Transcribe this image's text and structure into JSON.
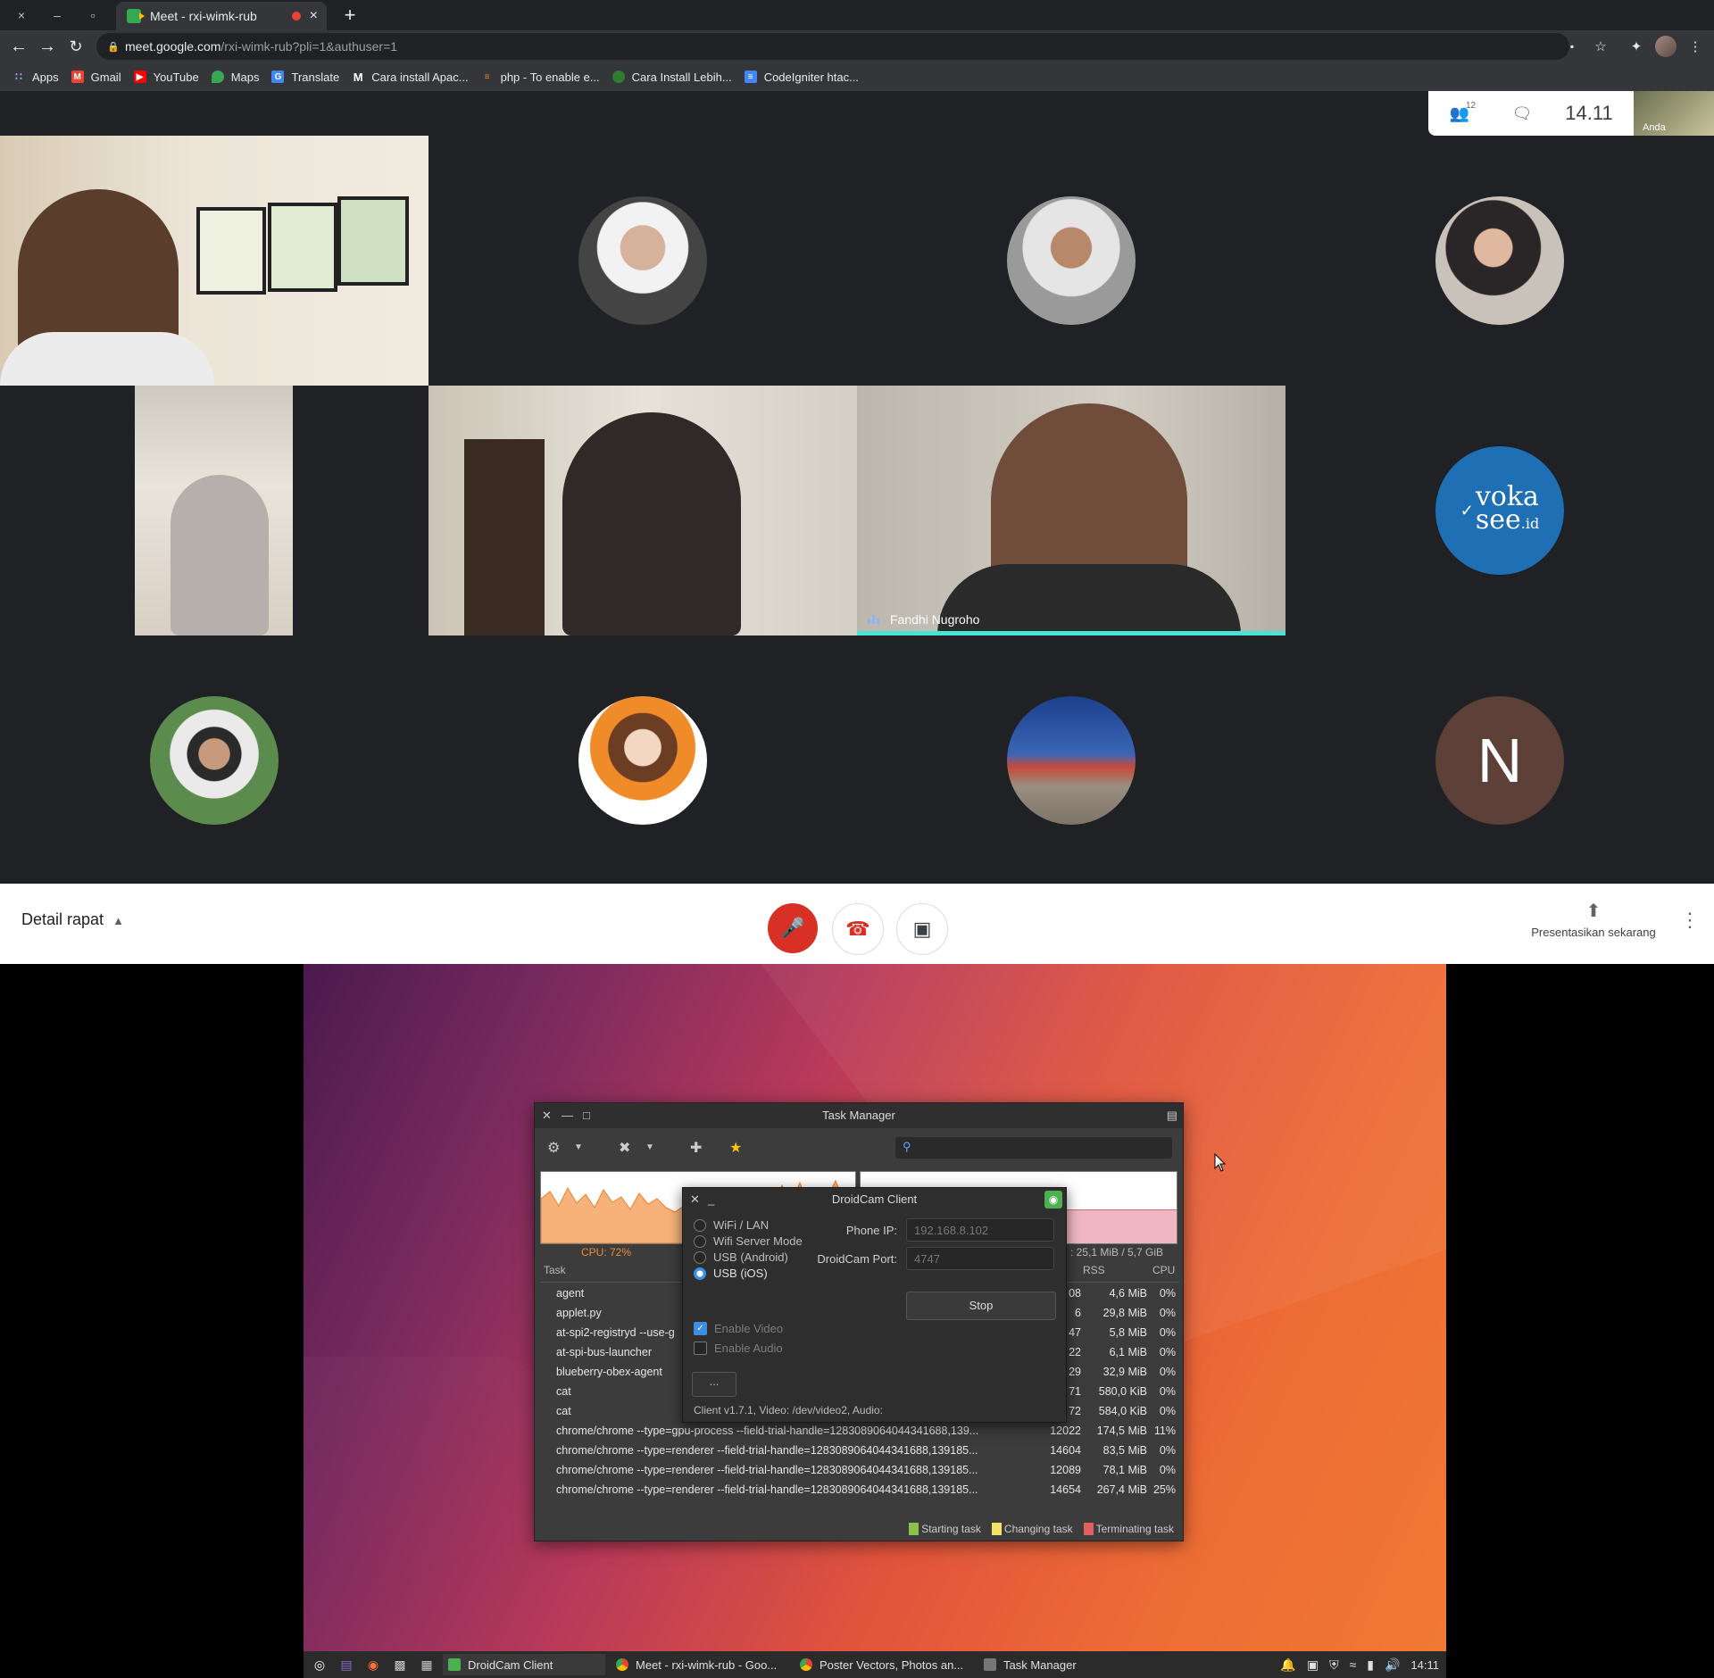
{
  "browser": {
    "window_controls": {
      "close": "×",
      "minimize": "–",
      "maximize": "▫"
    },
    "tab": {
      "title": "Meet - rxi-wimk-rub",
      "close": "×"
    },
    "new_tab": "+",
    "url": {
      "host": "meet.google.com",
      "path": "/rxi-wimk-rub?pli=1&authuser=1"
    },
    "bookmarks": [
      {
        "label": "Apps",
        "icon": "apps-grid-icon"
      },
      {
        "label": "Gmail",
        "icon": "gmail-icon"
      },
      {
        "label": "YouTube",
        "icon": "youtube-icon"
      },
      {
        "label": "Maps",
        "icon": "maps-icon"
      },
      {
        "label": "Translate",
        "icon": "translate-icon"
      },
      {
        "label": "Cara install Apac...",
        "icon": "medium-icon"
      },
      {
        "label": "php - To enable e...",
        "icon": "stackoverflow-icon"
      },
      {
        "label": "Cara Install Lebih...",
        "icon": "site-icon"
      },
      {
        "label": "CodeIgniter htac...",
        "icon": "doc-icon"
      }
    ]
  },
  "meet": {
    "participant_count": "12",
    "time": "14.11",
    "self_label": "Anda",
    "avatar_letter": "N",
    "avatar_logo": {
      "check": "✓",
      "line1": "voka",
      "line2": "see",
      "suffix": ".id"
    },
    "speaker_name": "Fandhi Nugroho",
    "meeting_details": "Detail rapat",
    "present_now": "Presentasikan sekarang",
    "colors": {
      "end_call": "#d93025",
      "speaking": "#48e3d2",
      "dark_bg": "#202124"
    }
  },
  "task_manager": {
    "title": "Task Manager",
    "cpu_label": "CPU: 72%",
    "mem_label": ": 25,1 MiB / 5,7 GiB",
    "columns": {
      "task": "Task",
      "rss": "RSS",
      "cpu": "CPU"
    },
    "rows": [
      {
        "name": "agent",
        "pid": "08",
        "rss": "4,6 MiB",
        "cpu": "0%"
      },
      {
        "name": "applet.py",
        "pid": "6",
        "rss": "29,8 MiB",
        "cpu": "0%"
      },
      {
        "name": "at-spi2-registryd --use-g",
        "pid": "47",
        "rss": "5,8 MiB",
        "cpu": "0%"
      },
      {
        "name": "at-spi-bus-launcher",
        "pid": "22",
        "rss": "6,1 MiB",
        "cpu": "0%"
      },
      {
        "name": "blueberry-obex-agent",
        "pid": "29",
        "rss": "32,9 MiB",
        "cpu": "0%"
      },
      {
        "name": "cat",
        "pid": "71",
        "rss": "580,0 KiB",
        "cpu": "0%"
      },
      {
        "name": "cat",
        "pid": "72",
        "rss": "584,0 KiB",
        "cpu": "0%"
      },
      {
        "name": "chrome/chrome --type=gpu-process --field-trial-handle=12830890640443416​88,139...",
        "pid": "12022",
        "rss": "174,5 MiB",
        "cpu": "11%"
      },
      {
        "name": "chrome/chrome --type=renderer --field-trial-handle=12830890640443416​88,139185...",
        "pid": "14604",
        "rss": "83,5 MiB",
        "cpu": "0%"
      },
      {
        "name": "chrome/chrome --type=renderer --field-trial-handle=12830890640443416​88,139185...",
        "pid": "12089",
        "rss": "78,1 MiB",
        "cpu": "0%"
      },
      {
        "name": "chrome/chrome --type=renderer --field-trial-handle=12830890640443416​88,139185...",
        "pid": "14654",
        "rss": "267,4 MiB",
        "cpu": "25%"
      }
    ],
    "legend": {
      "starting": "Starting task",
      "changing": "Changing task",
      "terminating": "Terminating task"
    },
    "legend_colors": {
      "starting": "#8bc34a",
      "changing": "#f2e46b",
      "terminating": "#e06060"
    }
  },
  "droidcam": {
    "title": "DroidCam Client",
    "modes": [
      "WiFi / LAN",
      "Wifi Server Mode",
      "USB (Android)",
      "USB (iOS)"
    ],
    "selected_mode": "USB (iOS)",
    "phone_ip_label": "Phone IP:",
    "phone_ip_value": "192.168.8.102",
    "port_label": "DroidCam Port:",
    "port_value": "4747",
    "stop_label": "Stop",
    "enable_video": "Enable Video",
    "enable_audio": "Enable Audio",
    "more_label": "...",
    "status": "Client v1.7.1, Video: /dev/video2, Audio:"
  },
  "taskbar": {
    "windows": [
      "DroidCam Client",
      "Meet - rxi-wimk-rub - Goo...",
      "Poster Vectors, Photos an...",
      "Task Manager"
    ],
    "clock": "14:11"
  }
}
